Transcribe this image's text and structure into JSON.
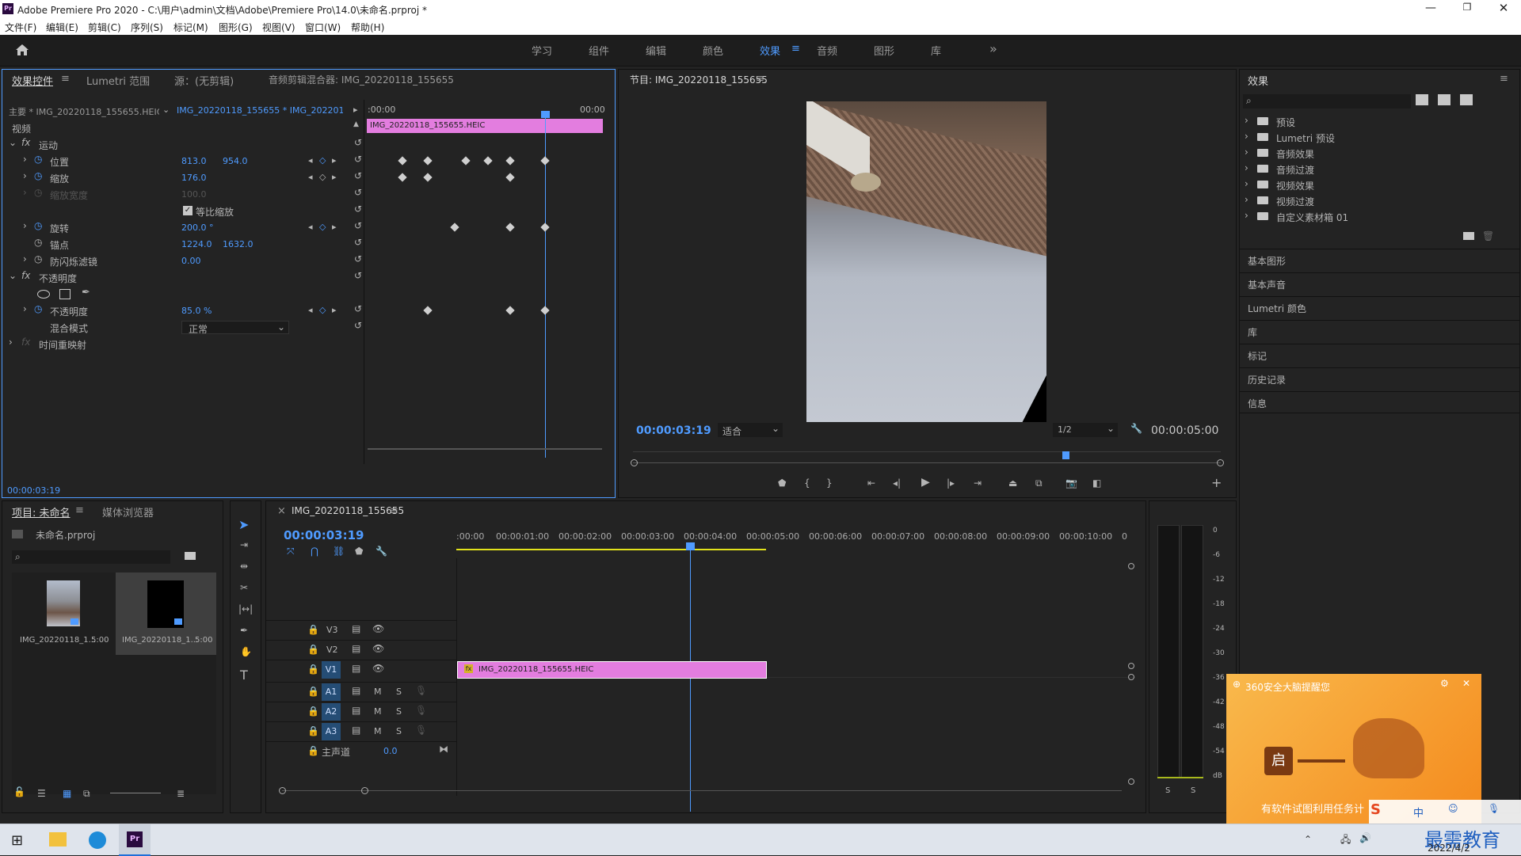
{
  "window": {
    "title": "Adobe Premiere Pro 2020 - C:\\用户\\admin\\文档\\Adobe\\Premiere Pro\\14.0\\未命名.prproj *",
    "app_icon": "Pr",
    "controls": [
      "minimize",
      "maximize",
      "close"
    ]
  },
  "menu": [
    "文件(F)",
    "编辑(E)",
    "剪辑(C)",
    "序列(S)",
    "标记(M)",
    "图形(G)",
    "视图(V)",
    "窗口(W)",
    "帮助(H)"
  ],
  "workspaces": {
    "items": [
      "学习",
      "组件",
      "编辑",
      "颜色",
      "效果",
      "音频",
      "图形",
      "库"
    ],
    "active": "效果",
    "more": "»"
  },
  "effect_controls": {
    "tabs": [
      "效果控件",
      "Lumetri 范围",
      "源：(无剪辑)",
      "音频剪辑混合器: IMG_20220118_155655"
    ],
    "master": "主要 * IMG_20220118_155655.HEIC",
    "clip_select": "IMG_20220118_155655 * IMG_202201...",
    "video_header": "视频",
    "time_start": ":00:00",
    "time_end": "00:00",
    "clip_bar": "IMG_20220118_155655.HEIC",
    "rows": [
      {
        "name": "运动",
        "type": "fx"
      },
      {
        "name": "位置",
        "v1": "813.0",
        "v2": "954.0"
      },
      {
        "name": "缩放",
        "v1": "176.0"
      },
      {
        "name": "缩放宽度",
        "v1": "100.0",
        "disabled": true
      },
      {
        "name": "等比缩放",
        "checkbox": true
      },
      {
        "name": "旋转",
        "v1": "200.0 °"
      },
      {
        "name": "锚点",
        "v1": "1224.0",
        "v2": "1632.0"
      },
      {
        "name": "防闪烁滤镜",
        "v1": "0.00"
      },
      {
        "name": "不透明度",
        "type": "fx"
      },
      {
        "name": "不透明度",
        "v1": "85.0 %"
      },
      {
        "name": "混合模式",
        "select": "正常"
      },
      {
        "name": "时间重映射",
        "type": "fx"
      }
    ],
    "timecode": "00:00:03:19"
  },
  "program": {
    "title": "节目: IMG_20220118_155655",
    "timecode": "00:00:03:19",
    "fit": "适合",
    "resolution": "1/2",
    "duration": "00:00:05:00"
  },
  "effects_panel": {
    "title": "效果",
    "tree": [
      "预设",
      "Lumetri 预设",
      "音频效果",
      "音频过渡",
      "视频效果",
      "视频过渡",
      "自定义素材箱 01"
    ],
    "sections": [
      "基本图形",
      "基本声音",
      "Lumetri 颜色",
      "库",
      "标记",
      "历史记录",
      "信息"
    ]
  },
  "project": {
    "tabs": [
      "项目: 未命名",
      "媒体浏览器"
    ],
    "file": "未命名.prproj",
    "items": [
      {
        "name": "IMG_20220118_1...",
        "duration": "5:00"
      },
      {
        "name": "IMG_20220118_1...",
        "duration": "5:00"
      }
    ]
  },
  "timeline": {
    "tab": "IMG_20220118_155655",
    "timecode": "00:00:03:19",
    "ruler": [
      ":00:00",
      "00:00:01:00",
      "00:00:02:00",
      "00:00:03:00",
      "00:00:04:00",
      "00:00:05:00",
      "00:00:06:00",
      "00:00:07:00",
      "00:00:08:00",
      "00:00:09:00",
      "00:00:10:00",
      "0"
    ],
    "video_tracks": [
      "V3",
      "V2",
      "V1"
    ],
    "audio_tracks": [
      "A1",
      "A2",
      "A3"
    ],
    "master": "主声道",
    "master_val": "0.0",
    "clip": "IMG_20220118_155655.HEIC",
    "m": "M",
    "s": "S"
  },
  "meter": {
    "scale": [
      "0",
      "-6",
      "-12",
      "-18",
      "-24",
      "-30",
      "-36",
      "-42",
      "-48",
      "-54",
      "dB"
    ],
    "solo": [
      "S",
      "S"
    ]
  },
  "popup": {
    "title": "360安全大脑提醒您",
    "badge": "启",
    "text": "有软件试图利用任务计"
  },
  "taskbar": {
    "date": "2022/4/2",
    "watermark": "最需教育",
    "ime": "中"
  }
}
